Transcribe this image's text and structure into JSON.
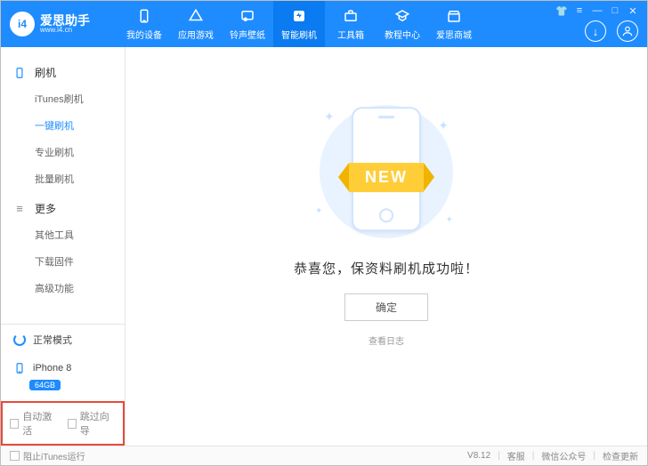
{
  "app": {
    "name_cn": "爱思助手",
    "name_en": "www.i4.cn",
    "logo_text": "i4"
  },
  "nav": [
    {
      "icon": "device",
      "label": "我的设备"
    },
    {
      "icon": "apps",
      "label": "应用游戏"
    },
    {
      "icon": "ring",
      "label": "铃声壁纸"
    },
    {
      "icon": "flash",
      "label": "智能刷机",
      "active": true
    },
    {
      "icon": "toolbox",
      "label": "工具箱"
    },
    {
      "icon": "tutorial",
      "label": "教程中心"
    },
    {
      "icon": "mall",
      "label": "爱思商城"
    }
  ],
  "sidebar": {
    "flash": {
      "title": "刷机",
      "items": [
        {
          "label": "iTunes刷机"
        },
        {
          "label": "一键刷机",
          "active": true
        },
        {
          "label": "专业刷机"
        },
        {
          "label": "批量刷机"
        }
      ]
    },
    "more": {
      "title": "更多",
      "items": [
        {
          "label": "其他工具"
        },
        {
          "label": "下载固件"
        },
        {
          "label": "高级功能"
        }
      ]
    },
    "mode": "正常模式",
    "device": {
      "name": "iPhone 8",
      "capacity": "64GB"
    },
    "opts": {
      "auto_activate": "自动激活",
      "skip_wizard": "跳过向导"
    }
  },
  "main": {
    "ribbon": "NEW",
    "message": "恭喜您，保资料刷机成功啦！",
    "ok": "确定",
    "log": "查看日志"
  },
  "footer": {
    "block_itunes": "阻止iTunes运行",
    "version": "V8.12",
    "links": [
      "客服",
      "微信公众号",
      "检查更新"
    ]
  }
}
